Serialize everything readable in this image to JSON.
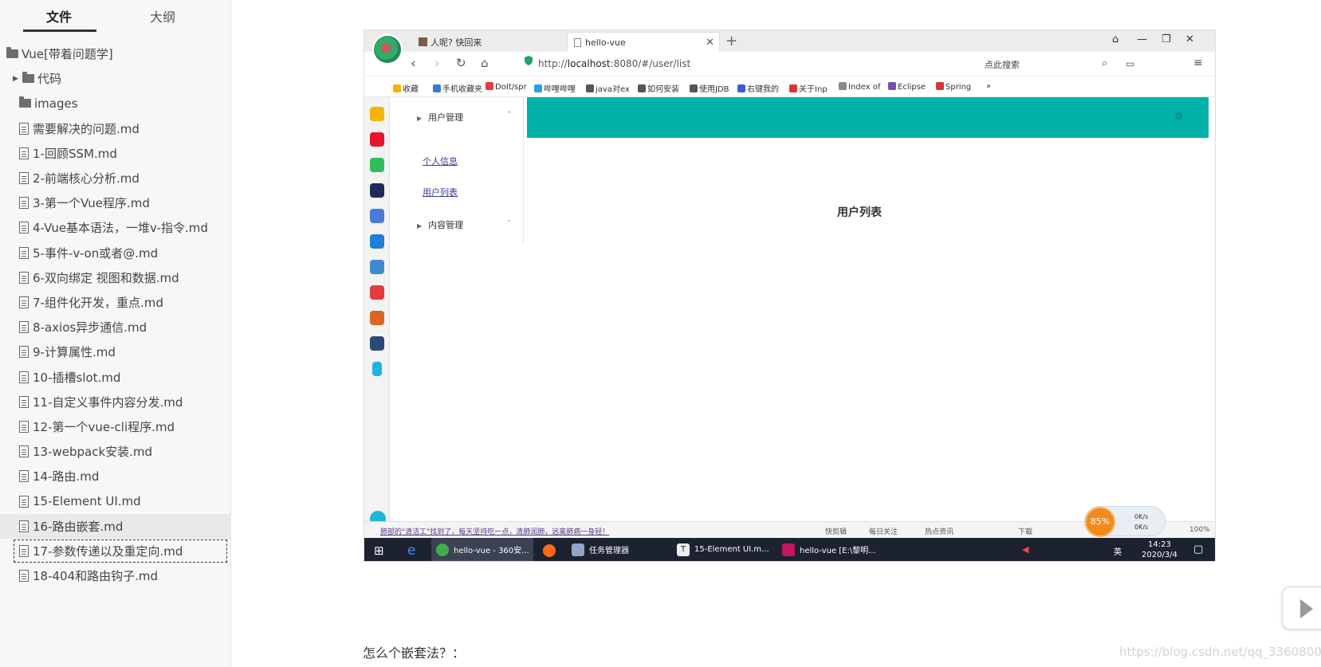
{
  "sidebar": {
    "tabs": [
      "文件",
      "大纲"
    ],
    "tree": [
      {
        "label": "Vue[带着问题学]",
        "type": "folder"
      },
      {
        "label": "代码",
        "type": "folder",
        "collapsed": true
      },
      {
        "label": "images",
        "type": "folder"
      },
      {
        "label": "需要解决的问题.md",
        "type": "file"
      },
      {
        "label": "1-回顾SSM.md",
        "type": "file"
      },
      {
        "label": "2-前端核心分析.md",
        "type": "file"
      },
      {
        "label": "3-第一个Vue程序.md",
        "type": "file"
      },
      {
        "label": "4-Vue基本语法，一堆v-指令.md",
        "type": "file"
      },
      {
        "label": "5-事件-v-on或者@.md",
        "type": "file"
      },
      {
        "label": "6-双向绑定 视图和数据.md",
        "type": "file"
      },
      {
        "label": "7-组件化开发，重点.md",
        "type": "file"
      },
      {
        "label": "8-axios异步通信.md",
        "type": "file"
      },
      {
        "label": "9-计算属性.md",
        "type": "file"
      },
      {
        "label": "10-插槽slot.md",
        "type": "file"
      },
      {
        "label": "11-自定义事件内容分发.md",
        "type": "file"
      },
      {
        "label": "12-第一个vue-cli程序.md",
        "type": "file"
      },
      {
        "label": "13-webpack安装.md",
        "type": "file"
      },
      {
        "label": "14-路由.md",
        "type": "file"
      },
      {
        "label": "15-Element UI.md",
        "type": "file"
      },
      {
        "label": "16-路由嵌套.md",
        "type": "file",
        "selected": true
      },
      {
        "label": "17-参数传递以及重定向.md",
        "type": "file",
        "focused": true
      },
      {
        "label": "18-404和路由钩子.md",
        "type": "file"
      }
    ]
  },
  "browser": {
    "tabs": [
      "人呢? 快回来",
      "hello-vue"
    ],
    "url_prefix": "http://",
    "url_host": "localhost",
    "url_rest": ":8080/#/user/list",
    "search_placeholder": "点此搜索",
    "bookmarks": [
      "收藏",
      "手机收藏夹",
      "DoIt/spr",
      "哔哩哔哩",
      "java对ex",
      "如何安装",
      "使用JDB",
      "右键我的",
      "关于Inp",
      "Index of",
      "Eclipse",
      "Spring",
      "»"
    ],
    "menu": {
      "group1": "用户管理",
      "link1": "个人信息",
      "link2": "用户列表",
      "group2": "内容管理"
    },
    "page_title": "用户列表",
    "status_left": "肺部的\"清洁工\"找到了，每天坚持吃一点，清肺润肺，远离肺病一身轻！",
    "status_items": [
      "快剪辑",
      "每日关注",
      "热点资讯",
      "下载",
      "100%"
    ],
    "speed": {
      "percent": "85%",
      "up": "0K/s",
      "down": "0K/s"
    },
    "taskbar": [
      "hello-vue - 360安...",
      "任务管理器",
      "15-Element UI.m...",
      "hello-vue [E:\\黎明..."
    ],
    "tray": {
      "lang": "英",
      "time": "14:23",
      "date": "2020/3/4"
    }
  },
  "document": {
    "text": "怎么个嵌套法？：",
    "watermark": "https://blog.csdn.net/qq_33608000"
  },
  "colors": {
    "header": "#00b2a9",
    "link": "#3a3aa0",
    "taskbar": "#1c2230"
  }
}
